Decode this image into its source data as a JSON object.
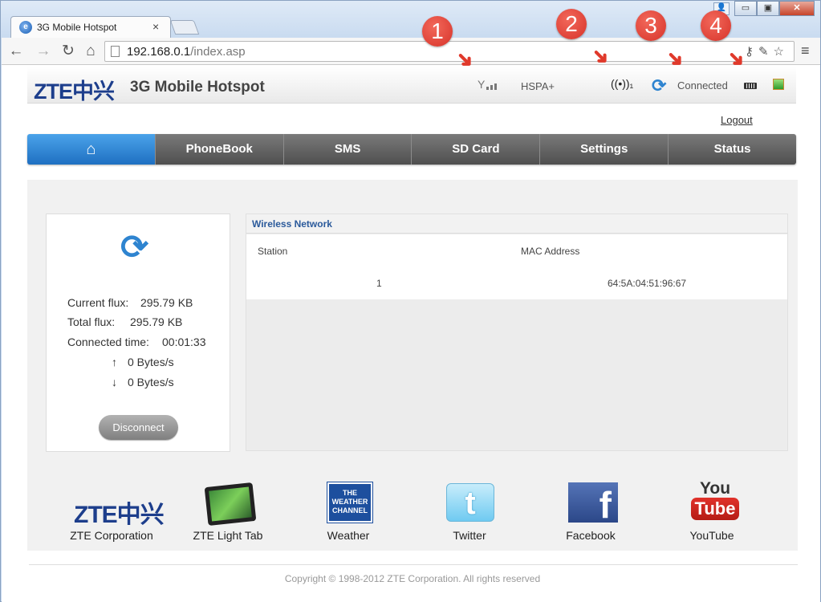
{
  "browser": {
    "tab_title": "3G Mobile Hotspot",
    "tab_close": "×",
    "url_host": "192.168.0.1",
    "url_path": "/index.asp",
    "back": "←",
    "forward": "→",
    "reload": "↻",
    "home": "⌂",
    "menu": "≡",
    "win_minimize": "▭",
    "win_maximize": "▣",
    "win_close": "✕"
  },
  "header": {
    "logo": "ZTE中兴",
    "title": "3G Mobile Hotspot",
    "network_type": "HSPA+",
    "connection_status": "Connected"
  },
  "logout": "Logout",
  "nav": {
    "home_icon": "⌂",
    "items": [
      "PhoneBook",
      "SMS",
      "SD Card",
      "Settings",
      "Status"
    ]
  },
  "flux": {
    "current_label": "Current flux:",
    "current_value": "295.79 KB",
    "total_label": "Total flux:",
    "total_value": "295.79 KB",
    "time_label": "Connected time:",
    "time_value": "00:01:33",
    "up_value": "0 Bytes/s",
    "down_value": "0 Bytes/s",
    "disconnect_label": "Disconnect"
  },
  "wireless": {
    "title": "Wireless Network",
    "columns": [
      "Station",
      "MAC Address"
    ],
    "rows": [
      {
        "station": "1",
        "mac": "64:5A:04:51:96:67"
      }
    ]
  },
  "links": [
    {
      "label": "ZTE Corporation",
      "icon": "zte-logo"
    },
    {
      "label": "ZTE Light Tab",
      "icon": "tablet-icon"
    },
    {
      "label": "Weather",
      "icon": "weather-channel-icon",
      "icon_text": "THE WEATHER CHANNEL"
    },
    {
      "label": "Twitter",
      "icon": "twitter-icon"
    },
    {
      "label": "Facebook",
      "icon": "facebook-icon"
    },
    {
      "label": "YouTube",
      "icon": "youtube-icon",
      "icon_you": "You",
      "icon_tube": "Tube"
    }
  ],
  "footer": "Copyright © 1998-2012 ZTE Corporation. All rights reserved",
  "callouts": [
    "1",
    "2",
    "3",
    "4"
  ]
}
